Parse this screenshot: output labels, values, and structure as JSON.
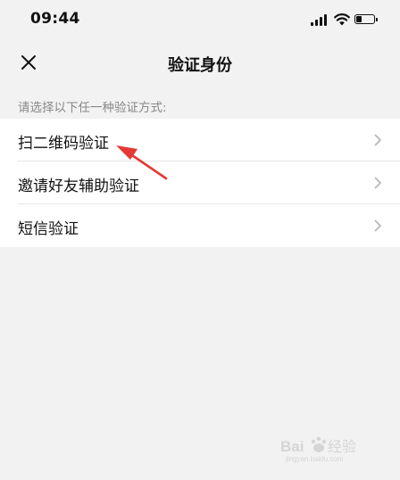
{
  "status_bar": {
    "time": "09:44"
  },
  "nav": {
    "title": "验证身份"
  },
  "hint": "请选择以下任一种验证方式:",
  "options": [
    {
      "label": "扫二维码验证"
    },
    {
      "label": "邀请好友辅助验证"
    },
    {
      "label": "短信验证"
    }
  ],
  "icons": {
    "close": "close-icon",
    "chevron": "chevron-right-icon",
    "signal": "cellular-signal-icon",
    "wifi": "wifi-icon",
    "battery": "battery-icon",
    "annotation": "red-arrow-annotation"
  },
  "colors": {
    "background": "#f2f2f2",
    "list_background": "#ffffff",
    "annotation_arrow": "#e53935",
    "hint_text": "#888888"
  }
}
